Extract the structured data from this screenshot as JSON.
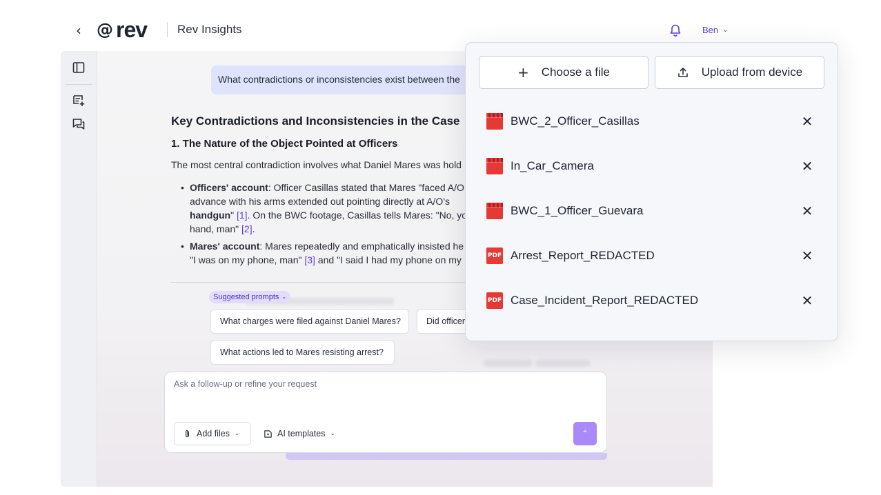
{
  "header": {
    "brand": "rev",
    "app_title": "Rev Insights",
    "user_name": "Ben"
  },
  "conversation": {
    "user_message": "What contradictions or inconsistencies exist between the",
    "heading": "Key Contradictions and Inconsistencies in the Case",
    "subheading": "1. The Nature of the Object Pointed at Officers",
    "intro": "The most central contradiction involves what Daniel Mares was hold",
    "bullets": [
      {
        "label": "Officers' account",
        "lines": [
          ": Officer Casillas stated that Mares \"faced A/O",
          "advance with his arms extended out pointing directly at A/O's",
          "handgun",
          "\" ",
          "[1]",
          ". On the BWC footage, Casillas tells Mares: \"No, yo",
          "hand, man\" ",
          "[2]",
          "."
        ]
      },
      {
        "label": "Mares' account",
        "lines": [
          ": Mares repeatedly and emphatically insisted he",
          "\"I was on my phone, man\" ",
          "[3]",
          " and \"I said I had my phone on my"
        ]
      }
    ]
  },
  "suggested_prompts": {
    "label": "Suggested prompts",
    "items": [
      "What charges were filed against Daniel Mares?",
      "Did officers Casillas",
      "What actions led to Mares resisting arrest?"
    ]
  },
  "composer": {
    "placeholder": "Ask a follow-up or refine your request",
    "add_files_label": "Add files",
    "ai_templates_label": "AI templates"
  },
  "file_popover": {
    "choose_file_label": "Choose a file",
    "upload_label": "Upload from device",
    "files": [
      {
        "name": "BWC_2_Officer_Casillas",
        "type": "video"
      },
      {
        "name": "In_Car_Camera",
        "type": "video"
      },
      {
        "name": "BWC_1_Officer_Guevara",
        "type": "video"
      },
      {
        "name": "Arrest_Report_REDACTED",
        "type": "pdf"
      },
      {
        "name": "Case_Incident_Report_REDACTED",
        "type": "pdf"
      }
    ],
    "pdf_badge": "PDF"
  },
  "colors": {
    "accent": "#5b3fd6",
    "file_icon": "#e53935",
    "send_button": "#a98af7"
  }
}
